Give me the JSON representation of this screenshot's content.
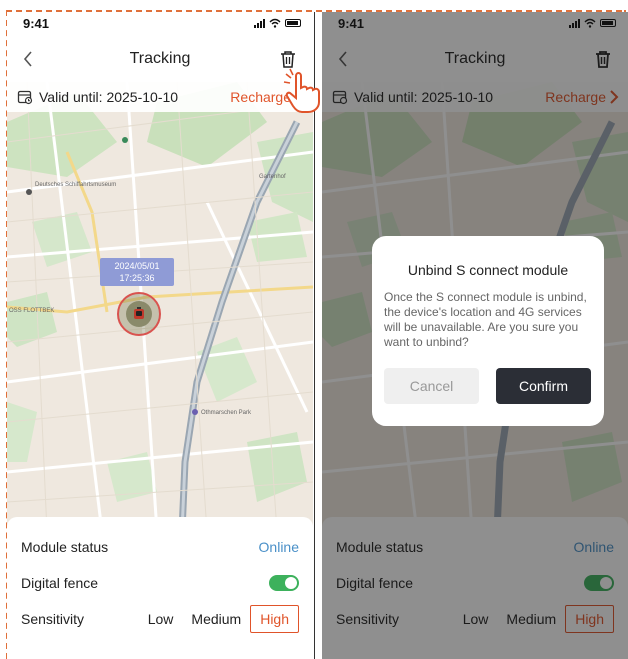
{
  "status_bar": {
    "time": "9:41"
  },
  "header": {
    "title": "Tracking"
  },
  "valid_bar": {
    "valid_text": "Valid until: 2025-10-10",
    "recharge_label": "Recharge"
  },
  "map": {
    "marker_date": "2024/05/01",
    "marker_time": "17:25:36",
    "place_labels": [
      "Deutsches Schiffahrtsmuseum",
      "OSS FLOTTBEK",
      "Othmarschen Park",
      "Gartenhof"
    ]
  },
  "panel": {
    "module_status_label": "Module status",
    "module_status_value": "Online",
    "digital_fence_label": "Digital fence",
    "digital_fence_on": true,
    "sensitivity_label": "Sensitivity",
    "sensitivity_options": [
      "Low",
      "Medium",
      "High"
    ],
    "sensitivity_selected": "High"
  },
  "dialog": {
    "title": "Unbind S connect module",
    "body": "Once the S connect module is unbind, the device's location and 4G services will be unavailable. Are you sure you want to unbind?",
    "cancel_label": "Cancel",
    "confirm_label": "Confirm"
  },
  "colors": {
    "accent": "#e0542a",
    "online": "#4a90c8",
    "toggle_on": "#3db15c",
    "confirm_bg": "#2b2e36",
    "guide_dash": "#e0703a",
    "marker_label_bg": "#8f9bd6"
  },
  "icons": {
    "back": "chevron-left-icon",
    "trash": "trash-icon",
    "valid": "calendar-clock-icon",
    "recharge": "chevron-right-icon",
    "cursor": "hand-pointer-icon"
  }
}
